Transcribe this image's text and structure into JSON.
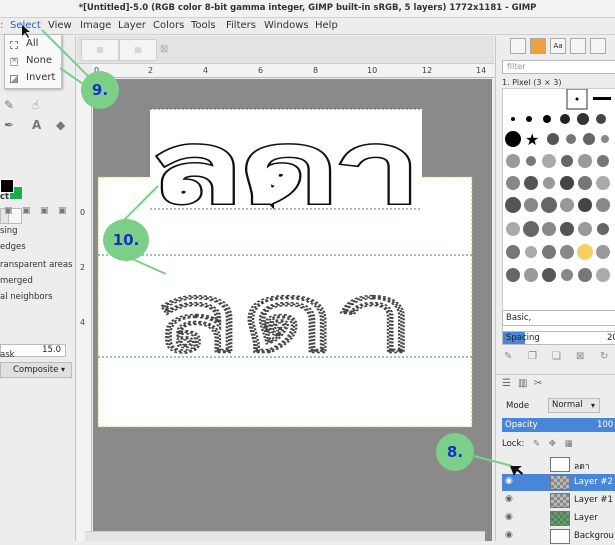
{
  "window": {
    "title": "*[Untitled]-5.0 (RGB color 8-bit gamma integer, GIMP built-in sRGB, 5 layers) 1772x1181 - GIMP"
  },
  "menubar": {
    "items": [
      "Select",
      "View",
      "Image",
      "Layer",
      "Colors",
      "Tools",
      "Filters",
      "Windows",
      "Help"
    ],
    "active": "Select"
  },
  "select_menu": {
    "items": [
      {
        "label": "All",
        "icon": "select-all-icon"
      },
      {
        "label": "None",
        "icon": "select-none-icon"
      },
      {
        "label": "Invert",
        "icon": "select-invert-icon"
      }
    ]
  },
  "tool_options": {
    "title_fragment": "ct",
    "lines": [
      "sing",
      "edges",
      "ransparent areas",
      "merged",
      "al neighbors"
    ],
    "threshold_value": "15.0",
    "composite_label": "Composite",
    "mask_fragment": "ask"
  },
  "colors": {
    "foreground": "#000000",
    "background": "#13b04b",
    "accent": "#4a86d8",
    "callout_fill": "#7ccf88",
    "callout_text": "#1630c8"
  },
  "rulers": {
    "horizontal_labels": [
      "0",
      "2",
      "4",
      "6",
      "8",
      "10",
      "12",
      "14"
    ],
    "vertical_labels": [
      "0",
      "2",
      "4"
    ]
  },
  "canvas": {
    "text_top": "ลดา",
    "text_bottom": "ลดา"
  },
  "brushes": {
    "filter_placeholder": "filter",
    "current_brush": "1. Pixel (3 × 3)",
    "preset": "Basic,",
    "spacing_label": "Spacing",
    "spacing_value": "20",
    "spacing_fraction": 0.2
  },
  "layers": {
    "mode_label": "Mode",
    "mode_value": "Normal",
    "opacity_label": "Opacity",
    "opacity_value": "100",
    "lock_label": "Lock:",
    "items": [
      {
        "name": "ลดา",
        "thumb": "white",
        "visible": false,
        "selected": false
      },
      {
        "name": "Layer #2",
        "thumb": "checker",
        "visible": true,
        "selected": true
      },
      {
        "name": "Layer #1",
        "thumb": "checker",
        "visible": true,
        "selected": false
      },
      {
        "name": "Layer",
        "thumb": "green",
        "visible": true,
        "selected": false
      },
      {
        "name": "Backgrou",
        "thumb": "white",
        "visible": true,
        "selected": false
      }
    ]
  },
  "annotations": {
    "step_9": "9.",
    "step_10": "10.",
    "step_8": "8."
  }
}
